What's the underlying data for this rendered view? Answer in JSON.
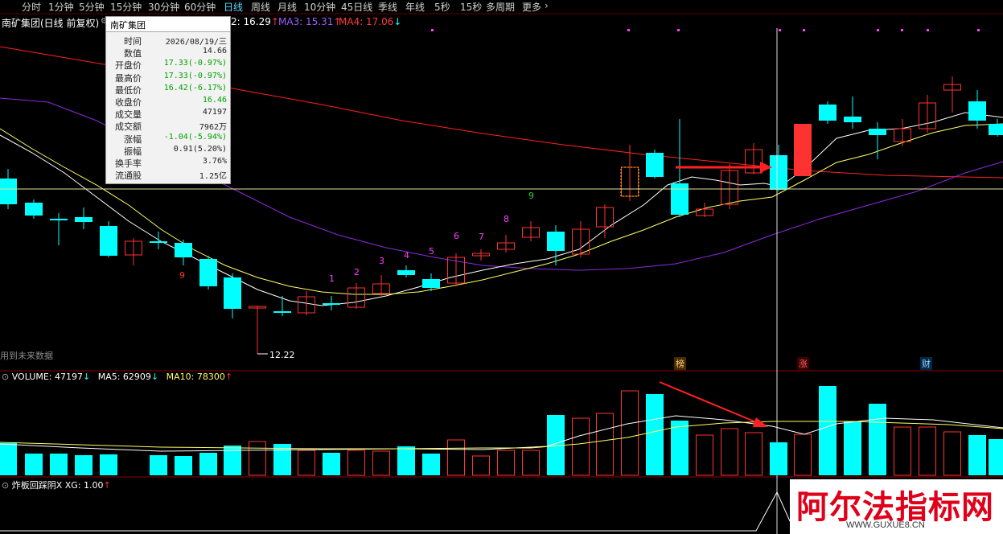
{
  "toolbar": {
    "periods": [
      "分时",
      "1分钟",
      "5分钟",
      "15分钟",
      "30分钟",
      "60分钟",
      "日线",
      "周线",
      "月线",
      "10分钟",
      "45日线",
      "季线",
      "年线",
      "5秒",
      "15秒",
      "多周期",
      "更多"
    ],
    "active": "日线",
    "more_arrow": "›"
  },
  "chart_header": {
    "title": "南矿集团(日线 前复权)",
    "ma2": "2: 16.29",
    "ma2_arrow": "↑",
    "ma3": "MA3: 15.31",
    "ma3_arrow": "↑",
    "ma4": "MA4: 17.06",
    "ma4_arrow": "↓"
  },
  "tooltip": {
    "title": "南矿集团",
    "rows": [
      {
        "k": "时间",
        "v": "2026/08/19/三",
        "color": "#222"
      },
      {
        "k": "数值",
        "v": "14.66",
        "color": "#222"
      },
      {
        "k": "开盘价",
        "v": "17.33(-0.97%)",
        "color": "#00a000"
      },
      {
        "k": "最高价",
        "v": "17.33(-0.97%)",
        "color": "#00a000"
      },
      {
        "k": "最低价",
        "v": "16.42(-6.17%)",
        "color": "#00a000"
      },
      {
        "k": "收盘价",
        "v": "16.46",
        "color": "#00a000"
      },
      {
        "k": "成交量",
        "v": "47197",
        "color": "#222"
      },
      {
        "k": "成交额",
        "v": "7962万",
        "color": "#222"
      },
      {
        "k": "涨幅",
        "v": "-1.04(-5.94%)",
        "color": "#00a000"
      },
      {
        "k": "振幅",
        "v": "0.91(5.20%)",
        "color": "#222"
      },
      {
        "k": "换手率",
        "v": "3.76%",
        "color": "#222"
      },
      {
        "k": "流通股",
        "v": "1.25亿",
        "color": "#222"
      }
    ]
  },
  "main_chart": {
    "low_label": "12.22",
    "future_note": "用到未来数据",
    "nine_count_label": "9",
    "tags": [
      "榜",
      "涨",
      "财"
    ],
    "seq_numbers": [
      "1",
      "2",
      "3",
      "4",
      "5",
      "6",
      "7",
      "8",
      "9"
    ]
  },
  "volume_header": {
    "volume": "VOLUME: 47197",
    "volume_arrow": "↓",
    "ma5": "MA5: 62909",
    "ma5_arrow": "↓",
    "ma10": "MA10: 78300",
    "ma10_arrow": "↑"
  },
  "indicator_header": {
    "name": "炸板回踩阴X XG: 1.00",
    "arrow": "↑"
  },
  "watermark": {
    "title": "阿尔法指标网",
    "url": "WWW.GUXUE8.CN"
  },
  "colors": {
    "up": "#ff3232",
    "down": "#00ffff",
    "ma_white": "#ffffff",
    "ma_yellow": "#ffff66",
    "ma_purple": "#8a2be2",
    "ma_red": "#ff2020",
    "magenta": "#ff40ff"
  }
}
